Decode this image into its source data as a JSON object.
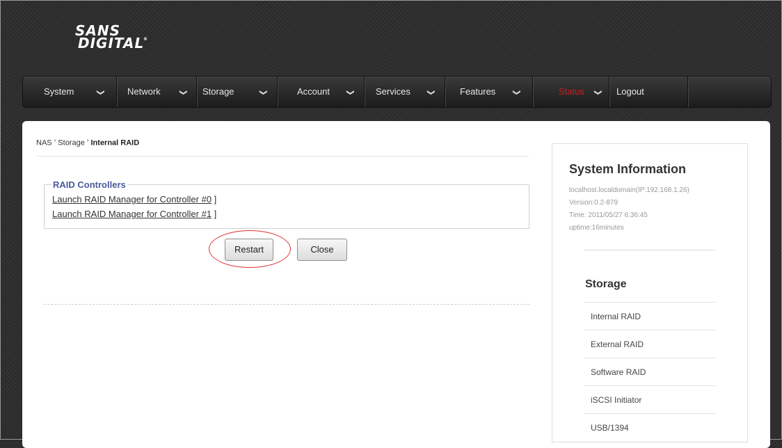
{
  "logo": {
    "line1": "SANS",
    "line2": "DIGITAL",
    "reg": "®"
  },
  "nav": {
    "items": [
      {
        "label": "System",
        "has_dropdown": true
      },
      {
        "label": "Network",
        "has_dropdown": true
      },
      {
        "label": "Storage",
        "has_dropdown": true
      },
      {
        "label": "Account",
        "has_dropdown": true
      },
      {
        "label": "Services",
        "has_dropdown": true
      },
      {
        "label": "Features",
        "has_dropdown": true
      },
      {
        "label": "Status",
        "has_dropdown": true,
        "active": true
      },
      {
        "label": "Logout",
        "has_dropdown": false
      }
    ],
    "chevron": "❯",
    "active_color": "#d11a1a"
  },
  "breadcrumb": {
    "root": "NAS",
    "level1": "Storage",
    "current": "Internal RAID",
    "separator": "›"
  },
  "raid_controllers": {
    "legend": "RAID Controllers",
    "links": [
      {
        "label": "Launch RAID Manager for Controller #0",
        "suffix": " ]"
      },
      {
        "label": "Launch RAID Manager for Controller #1",
        "suffix": " ]"
      }
    ]
  },
  "buttons": {
    "restart": "Restart",
    "close": "Close"
  },
  "annotation_color": "#d33333",
  "system_info": {
    "title": "System Information",
    "host": "localhost.localdomain(IP:192.168.1.26)",
    "version": "Version:0.2-879",
    "time": "Time: 2011/05/27 6:36:45",
    "uptime": "uptime:16minutes"
  },
  "storage_menu": {
    "title": "Storage",
    "items": [
      "Internal RAID",
      "External RAID",
      "Software RAID",
      "iSCSI Initiator",
      "USB/1394"
    ]
  }
}
